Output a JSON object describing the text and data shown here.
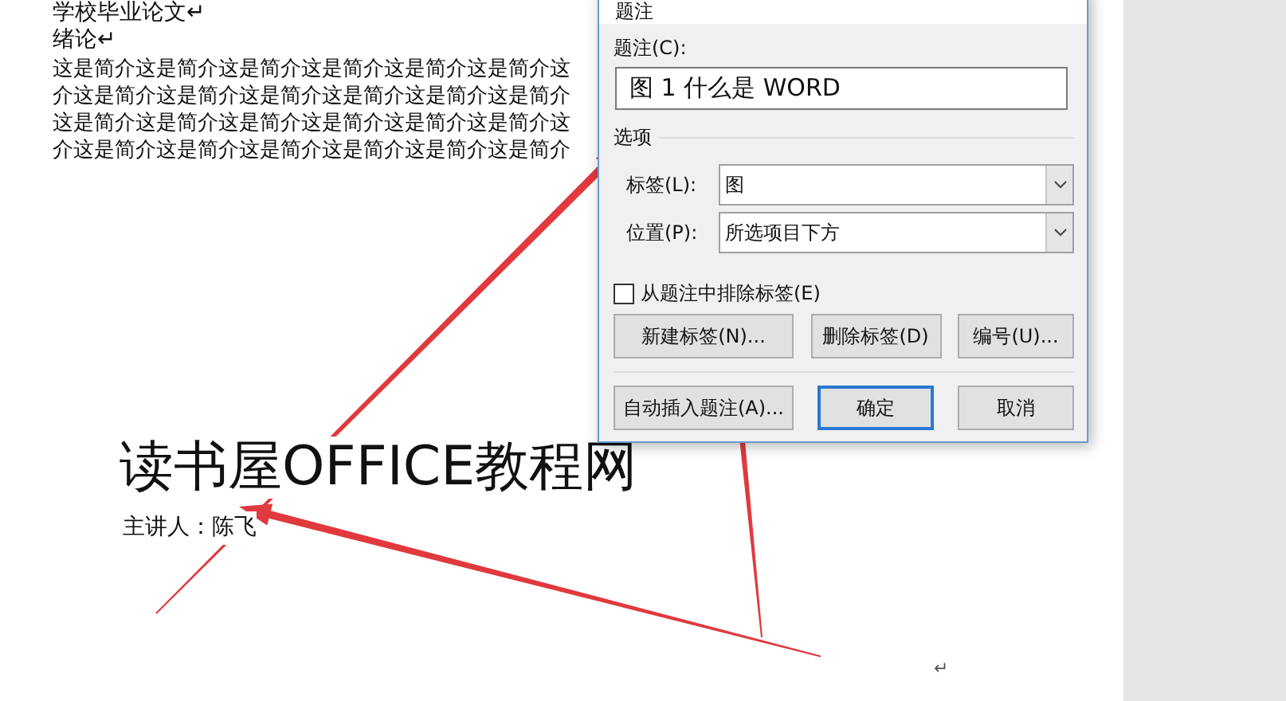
{
  "document": {
    "lines": [
      {
        "kind": "heading",
        "text": "学校毕业论文↵"
      },
      {
        "kind": "heading",
        "text": "绪论↵"
      },
      {
        "kind": "body",
        "text": "这是简介这是简介这是简介这是简介这是简介这是简介这"
      },
      {
        "kind": "body",
        "text": "介这是简介这是简介这是简介这是简介这是简介这是简介"
      },
      {
        "kind": "body",
        "text": "这是简介这是简介这是简介这是简介这是简介这是简介这"
      },
      {
        "kind": "body",
        "text": "介这是简介这是简介这是简介这是简介这是简介这是简介"
      }
    ],
    "title": "读书屋OFFICE教程网",
    "subtitle": "主讲人：陈飞",
    "end_mark": "↵"
  },
  "dialog": {
    "title": "题注",
    "caption_label": "题注(C):",
    "caption_value": "图 1 什么是 WORD",
    "options_label": "选项",
    "fields": [
      {
        "label": "标签(L):",
        "value": "图"
      },
      {
        "label": "位置(P):",
        "value": "所选项目下方"
      }
    ],
    "checkbox": {
      "label": "从题注中排除标签(E)",
      "checked": false
    },
    "buttons": [
      {
        "label": "新建标签(N)...",
        "default": false
      },
      {
        "label": "删除标签(D)",
        "default": false
      },
      {
        "label": "编号(U)...",
        "default": false
      }
    ],
    "bottom_buttons": [
      {
        "label": "自动插入题注(A)...",
        "default": false
      },
      {
        "label": "确定",
        "default": true
      },
      {
        "label": "取消",
        "default": false
      }
    ]
  }
}
